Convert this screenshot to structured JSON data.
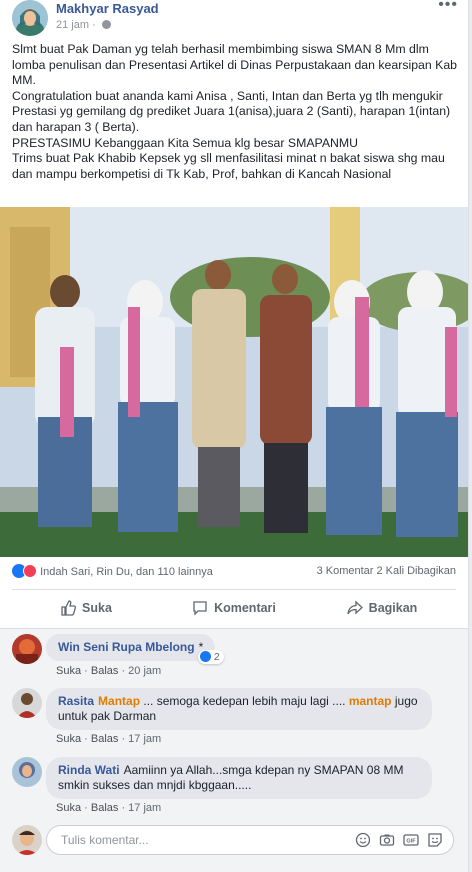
{
  "post": {
    "author": "Makhyar Rasyad",
    "time": "21 jam",
    "separator": "·",
    "more": "•••",
    "paragraphs": [
      "Slmt buat Pak Daman yg telah berhasil membimbing siswa SMAN 8 Mm dlm lomba penulisan dan Presentasi Artikel di Dinas Perpustakaan dan kearsipan Kab MM.",
      "Congratulation buat ananda kami Anisa , Santi, Intan dan Berta yg tlh mengukir Prestasi yg gemilang dg prediket Juara 1(anisa),juara 2 (Santi), harapan 1(intan) dan harapan 3 ( Berta).",
      "PRESTASIMU Kebanggaan Kita Semua klg besar SMAPANMU",
      "Trims buat Pak Khabib Kepsek yg sll menfasilitasi minat n bakat siswa shg mau dan mampu berkompetisi di Tk Kab, Prof, bahkan di Kancah Nasional"
    ]
  },
  "stats": {
    "reactors": "Indah Sari, Rin Du, dan 110 lainnya",
    "comments": "3 Komentar",
    "shares": "2 Kali Dibagikan"
  },
  "actions": {
    "like": "Suka",
    "comment": "Komentari",
    "share": "Bagikan"
  },
  "comments": [
    {
      "name": "Win Seni Rupa Mbelong",
      "suffix": "*",
      "text_parts": [],
      "like": "Suka",
      "reply": "Balas",
      "time": "20 jam",
      "likes": "2"
    },
    {
      "name": "Rasita",
      "text_parts": [
        {
          "t": "Mantap",
          "hl": true
        },
        {
          "t": " ... semoga kedepan lebih maju lagi .... ",
          "hl": false
        },
        {
          "t": "mantap",
          "hl": true
        },
        {
          "t": " jugo untuk pak Darman",
          "hl": false
        }
      ],
      "like": "Suka",
      "reply": "Balas",
      "time": "17 jam"
    },
    {
      "name": "Rinda Wati",
      "text_parts": [
        {
          "t": "Aamiinn ya Allah...smga kdepan ny SMAPAN 08 MM smkin sukses dan mnjdi kbggaan.....",
          "hl": false
        }
      ],
      "like": "Suka",
      "reply": "Balas",
      "time": "17 jam"
    }
  ],
  "composer": {
    "placeholder": "Tulis komentar..."
  },
  "colors": {
    "link": "#385898",
    "highlight": "#e07c00",
    "like_blue": "#1877f2",
    "love_red": "#f33e58"
  },
  "icons": [
    "globe-icon",
    "like-icon",
    "comment-icon",
    "share-icon",
    "emoji-icon",
    "camera-icon",
    "gif-icon",
    "sticker-icon"
  ]
}
